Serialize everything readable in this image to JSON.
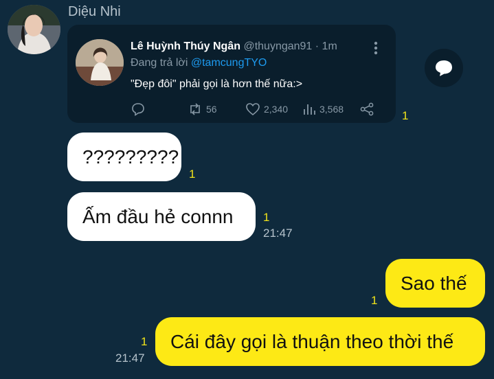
{
  "chat": {
    "sender_name": "Diệu Nhi"
  },
  "tweet": {
    "author_name": "Lê Huỳnh Thúy Ngân",
    "author_handle": "@thuyngan91",
    "time": " · 1m",
    "reply_prefix": "Đang trả lời ",
    "reply_mention": "@tamcungTYO",
    "text": "\"Đẹp đôi\" phải gọi là hơn thế nữa:>",
    "retweets": "56",
    "likes": "2,340",
    "views": "3,568"
  },
  "messages": [
    {
      "side": "left",
      "text": "",
      "read_count": "1"
    },
    {
      "side": "left",
      "text": "?????????",
      "read_count": "1"
    },
    {
      "side": "left",
      "text": "Ấm đầu hẻ connn",
      "read_count": "1",
      "time": "21:47"
    },
    {
      "side": "right",
      "text": "Sao thế",
      "read_count": "1"
    },
    {
      "side": "right",
      "text": "Cái đây gọi là thuận theo thời thế",
      "read_count": "1",
      "time": "21:47"
    }
  ],
  "colors": {
    "background": "#0f2a3d",
    "card": "#0a1e2c",
    "incoming_bubble": "#ffffff",
    "outgoing_bubble": "#fde915",
    "read_marker": "#f0e21a",
    "mention": "#1d9bf0"
  }
}
